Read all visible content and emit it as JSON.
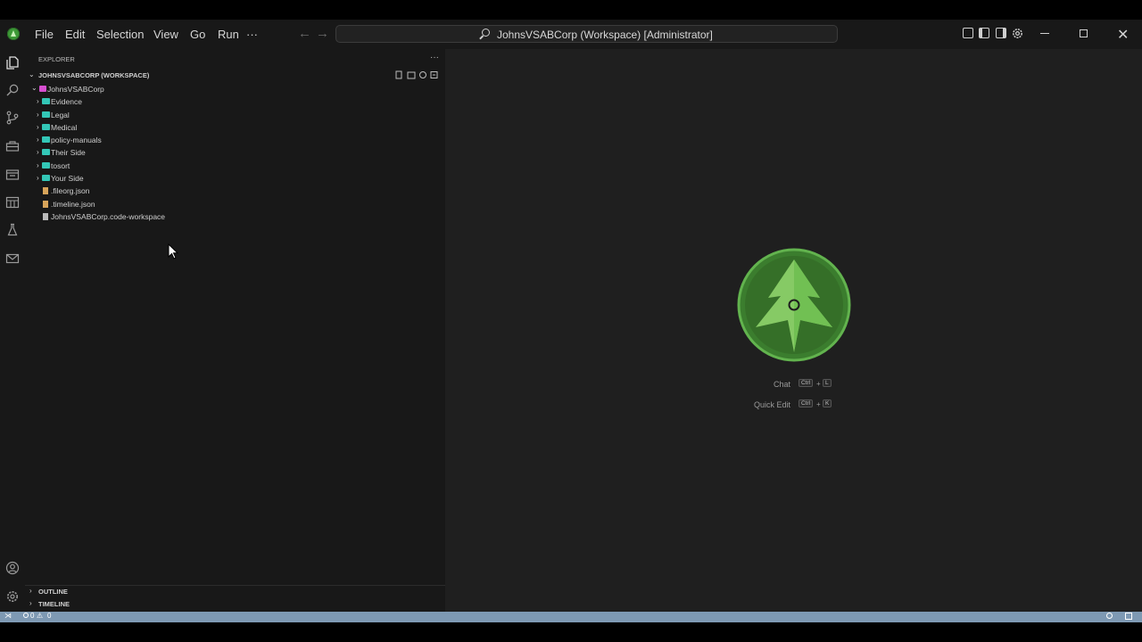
{
  "window": {
    "menu": [
      "File",
      "Edit",
      "Selection",
      "View",
      "Go",
      "Run",
      "···"
    ],
    "command_center_text": "JohnsVSABCorp (Workspace) [Administrator]",
    "nav_back_glyph": "←",
    "nav_forward_glyph": "→",
    "close_glyph": "✕"
  },
  "explorer": {
    "title": "EXPLORER",
    "more_glyph": "···",
    "workspace": "JOHNSVSABCORP (WORKSPACE)",
    "root": "JohnsVSABCorp",
    "items": [
      {
        "label": "Evidence",
        "kind": "folder"
      },
      {
        "label": "Legal",
        "kind": "folder"
      },
      {
        "label": "Medical",
        "kind": "folder"
      },
      {
        "label": "policy-manuals",
        "kind": "folder"
      },
      {
        "label": "Their Side",
        "kind": "folder"
      },
      {
        "label": "tosort",
        "kind": "folder"
      },
      {
        "label": "Your Side",
        "kind": "folder"
      },
      {
        "label": ".fileorg.json",
        "kind": "json"
      },
      {
        "label": ".timeline.json",
        "kind": "json"
      },
      {
        "label": "JohnsVSABCorp.code-workspace",
        "kind": "workspace"
      }
    ],
    "outline": "OUTLINE",
    "timeline": "TIMELINE"
  },
  "editor": {
    "shortcuts": [
      {
        "label": "Chat",
        "keys": [
          "Ctrl",
          "+",
          "L"
        ]
      },
      {
        "label": "Quick Edit",
        "keys": [
          "Ctrl",
          "+",
          "K"
        ]
      }
    ]
  },
  "status": {
    "errors": "0",
    "warnings": "0"
  },
  "colors": {
    "accent_green": "#4a9e3e",
    "folder": "#33c7b7",
    "status_bar": "#7e99b3"
  }
}
